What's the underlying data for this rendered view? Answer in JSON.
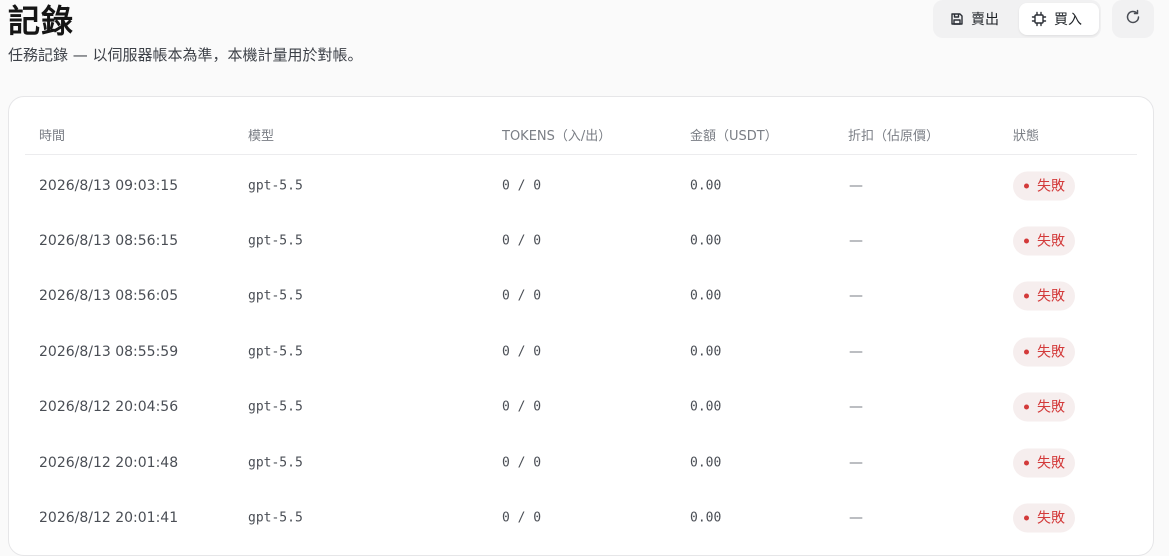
{
  "page": {
    "title": "記錄",
    "subtitle": "任務記錄 — 以伺服器帳本為準，本機計量用於對帳。"
  },
  "toolbar": {
    "sell_label": "賣出",
    "sell_icon": "save-icon",
    "buy_label": "買入",
    "buy_icon": "chip-icon",
    "active_mode": "buy",
    "refresh_icon": "refresh-icon"
  },
  "table": {
    "headers": {
      "time": "時間",
      "model": "模型",
      "tokens": "TOKENS（入/出）",
      "amount": "金額（USDT）",
      "discount": "折扣（佔原價）",
      "status": "狀態"
    },
    "rows": [
      {
        "time": "2026/8/13 09:03:15",
        "model": "gpt-5.5",
        "tokens": "0 / 0",
        "amount": "0.00",
        "discount": "—",
        "status": "失敗"
      },
      {
        "time": "2026/8/13 08:56:15",
        "model": "gpt-5.5",
        "tokens": "0 / 0",
        "amount": "0.00",
        "discount": "—",
        "status": "失敗"
      },
      {
        "time": "2026/8/13 08:56:05",
        "model": "gpt-5.5",
        "tokens": "0 / 0",
        "amount": "0.00",
        "discount": "—",
        "status": "失敗"
      },
      {
        "time": "2026/8/13 08:55:59",
        "model": "gpt-5.5",
        "tokens": "0 / 0",
        "amount": "0.00",
        "discount": "—",
        "status": "失敗"
      },
      {
        "time": "2026/8/12 20:04:56",
        "model": "gpt-5.5",
        "tokens": "0 / 0",
        "amount": "0.00",
        "discount": "—",
        "status": "失敗"
      },
      {
        "time": "2026/8/12 20:01:48",
        "model": "gpt-5.5",
        "tokens": "0 / 0",
        "amount": "0.00",
        "discount": "—",
        "status": "失敗"
      },
      {
        "time": "2026/8/12 20:01:41",
        "model": "gpt-5.5",
        "tokens": "0 / 0",
        "amount": "0.00",
        "discount": "—",
        "status": "失敗"
      }
    ]
  },
  "colors": {
    "failed": "#d33a3a",
    "failed_bg": "#f6eeee"
  }
}
